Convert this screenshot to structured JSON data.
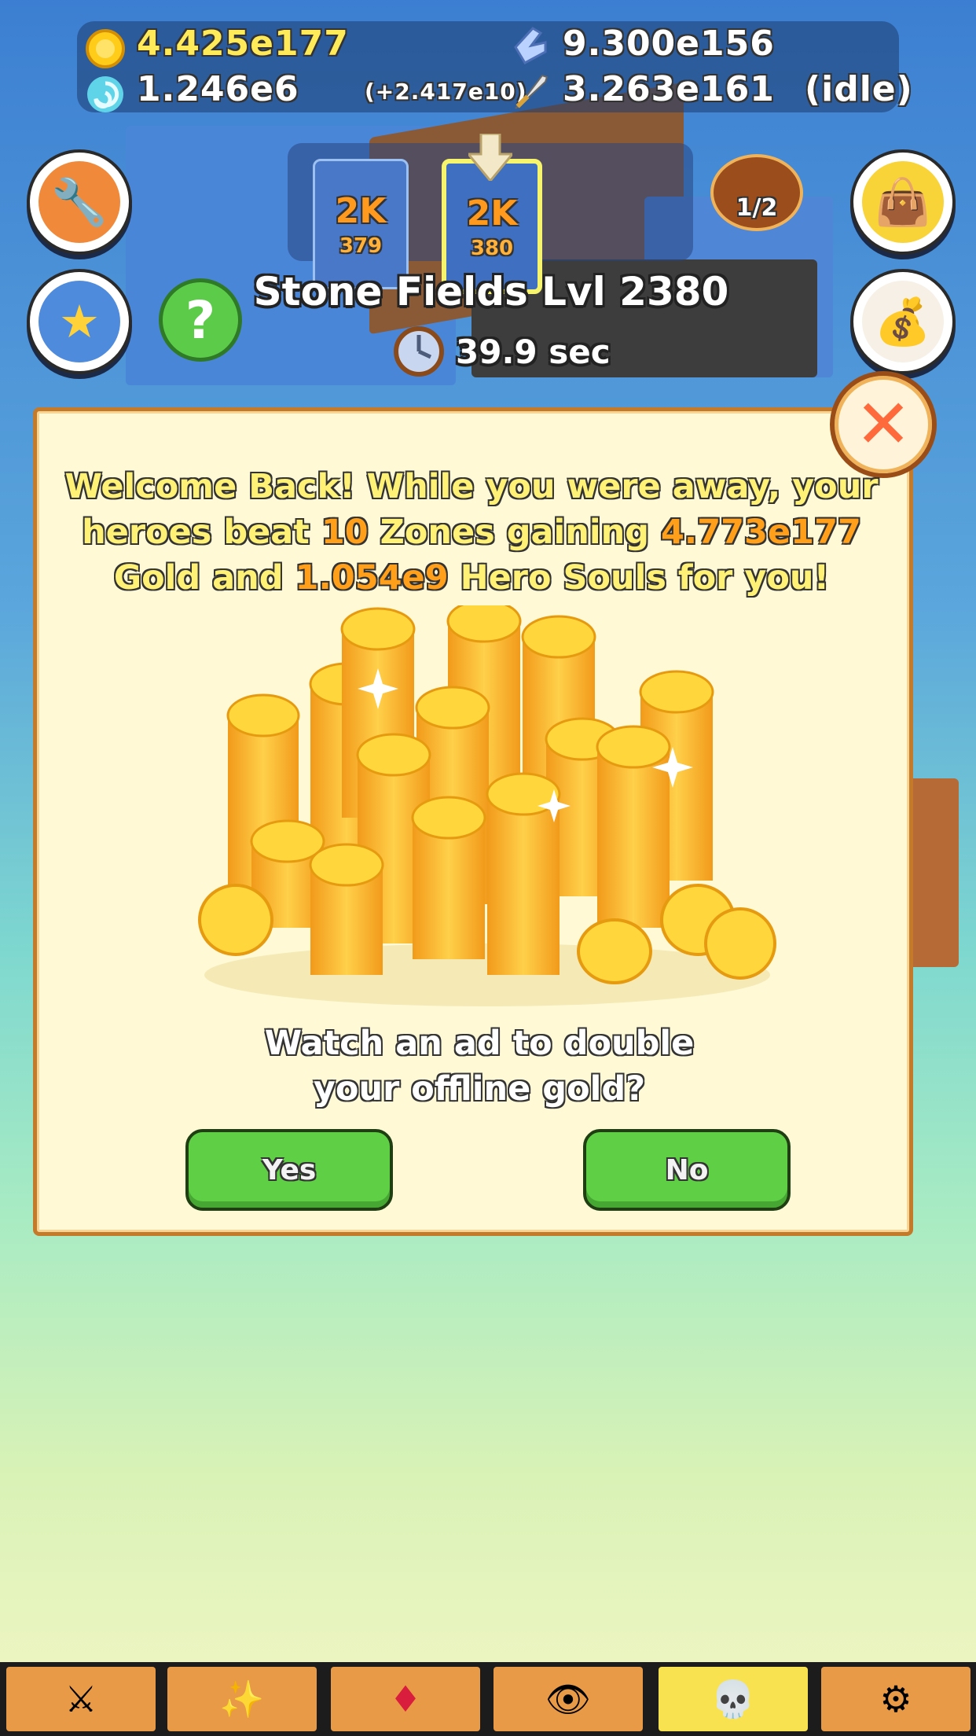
{
  "stats": {
    "gold": "4.425e177",
    "hero_souls": "1.246e6",
    "souls_gain": "(+2.417e10)",
    "click_damage": "9.300e156",
    "dps": "3.263e161",
    "mode": "(idle)"
  },
  "zones": [
    {
      "label": "2K",
      "number": "379"
    },
    {
      "label": "2K",
      "number": "380"
    }
  ],
  "quest_counter": "1/2",
  "zone_title": "Stone Fields Lvl 2380",
  "timer": "39.9 sec",
  "dialog": {
    "line1_a": "Welcome Back!  While you were away, your",
    "line2_a": "heroes beat ",
    "zones_beaten": "10",
    "line2_b": " Zones gaining ",
    "gold_gained": "4.773e177",
    "line3_a": "Gold and ",
    "souls_gained": "1.054e9",
    "line3_b": " Hero Souls for you!",
    "prompt_line1": "Watch an ad to double",
    "prompt_line2": "your offline gold?",
    "yes_label": "Yes",
    "no_label": "No"
  },
  "icons": {
    "side_left": [
      "wrench-icon",
      "stars-icon",
      "help-icon"
    ],
    "side_right": [
      "winged-bag-icon",
      "ruby-bag-icon"
    ],
    "tabs": [
      "crossed-swords-icon",
      "magic-wand-icon",
      "ruby-icon",
      "eye-pyramid-icon",
      "skull-icon",
      "gear-eye-icon"
    ]
  },
  "colors": {
    "accent_yellow": "#fff176",
    "accent_orange": "#ff9f1a",
    "button_green": "#5fcf45",
    "tab_orange": "#e99a46",
    "tab_active": "#f8e24f"
  }
}
